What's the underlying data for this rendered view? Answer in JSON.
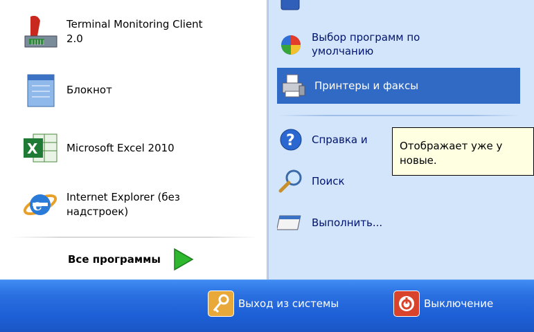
{
  "left_programs": [
    {
      "icon": "terminal-monitoring-icon",
      "lines": [
        "Terminal Monitoring Client",
        "2.0"
      ]
    },
    {
      "icon": "notepad-icon",
      "lines": [
        "Блокнот"
      ]
    },
    {
      "icon": "excel-icon",
      "lines": [
        "Microsoft Excel 2010"
      ]
    },
    {
      "icon": "internet-explorer-icon",
      "lines": [
        "Internet Explorer (без",
        "надстроек)"
      ]
    }
  ],
  "all_programs": {
    "label": "Все программы"
  },
  "right_items": [
    {
      "icon": "default-programs-icon",
      "lines": [
        "Выбор программ по",
        "умолчанию"
      ]
    },
    {
      "icon": "printers-faxes-icon",
      "lines": [
        "Принтеры и факсы"
      ],
      "selected": true
    },
    {
      "icon": "help-icon",
      "lines": [
        "Справка и"
      ]
    },
    {
      "icon": "search-icon",
      "lines": [
        "Поиск"
      ]
    },
    {
      "icon": "run-icon",
      "lines": [
        "Выполнить..."
      ]
    }
  ],
  "tooltip": {
    "lines": [
      "Отображает уже у",
      "новые."
    ]
  },
  "bottom": {
    "logoff_label": "Выход из системы",
    "shutdown_label": "Выключение"
  },
  "colors": {
    "accent": "#316ac5",
    "right_panel": "#d3e5fa",
    "taskbar": "#1d5fd6",
    "tooltip_bg": "#ffffe1"
  }
}
